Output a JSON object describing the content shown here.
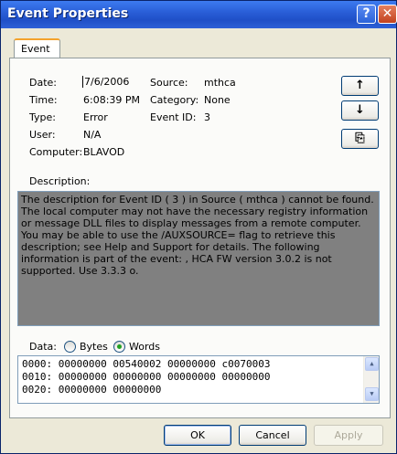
{
  "window": {
    "title": "Event Properties",
    "help_glyph": "?",
    "close_glyph": "✕"
  },
  "tabs": [
    {
      "label": "Event"
    }
  ],
  "fields": {
    "date_label": "Date:",
    "date_value": "7/6/2006",
    "source_label": "Source:",
    "source_value": "mthca",
    "time_label": "Time:",
    "time_value": "6:08:39 PM",
    "category_label": "Category:",
    "category_value": "None",
    "type_label": "Type:",
    "type_value": "Error",
    "event_id_label": "Event ID:",
    "event_id_value": "3",
    "user_label": "User:",
    "user_value": "N/A",
    "computer_label": "Computer:",
    "computer_value": "BLAVOD"
  },
  "nav_buttons": {
    "up_glyph": "↑",
    "down_glyph": "↓",
    "copy_glyph": "⎘"
  },
  "description": {
    "label": "Description:",
    "text": "The description for Event ID ( 3 ) in Source ( mthca ) cannot be found. The local computer may not have the necessary registry information or message DLL files to display messages from a remote computer. You may be able to use the /AUXSOURCE= flag to retrieve this description; see Help and Support for details. The following information is part of the event: , HCA FW version 3.0.2 is not supported. Use 3.3.3 o."
  },
  "data": {
    "label": "Data:",
    "bytes_label": "Bytes",
    "words_label": "Words",
    "selected": "words",
    "lines": [
      "0000: 00000000 00540002 00000000 c0070003",
      "0010: 00000000 00000000 00000000 00000000",
      "0020: 00000000 00000000"
    ]
  },
  "buttons": {
    "ok": "OK",
    "cancel": "Cancel",
    "apply": "Apply"
  }
}
